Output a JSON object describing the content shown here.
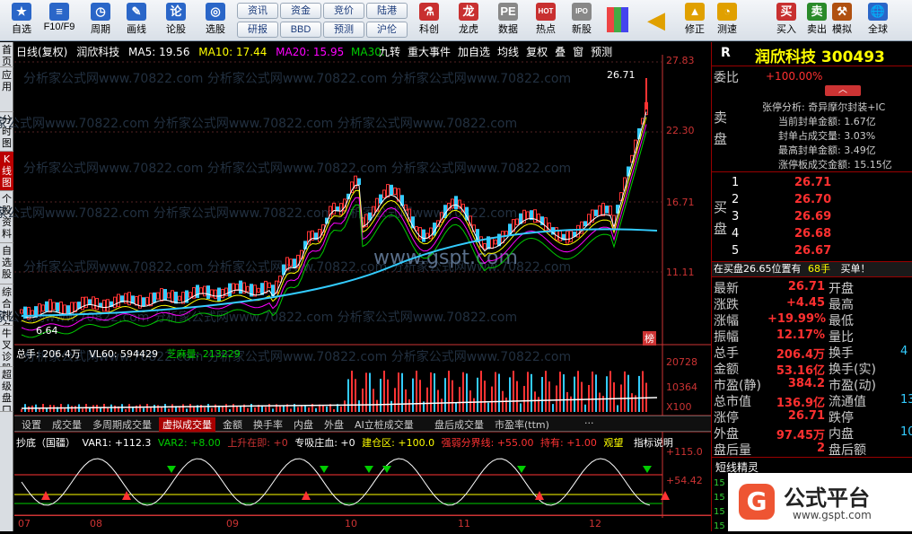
{
  "toolbar": {
    "buttons": [
      {
        "label": "自选",
        "icon": "star-icon",
        "color": "#2a66c8"
      },
      {
        "label": "F10/F9",
        "icon": "f10-icon",
        "color": "#2a66c8"
      },
      {
        "label": "周期",
        "icon": "clock-icon",
        "color": "#2a66c8"
      },
      {
        "label": "画线",
        "icon": "pencil-icon",
        "color": "#2a66c8"
      },
      {
        "label": "论股",
        "icon": "discuss-icon",
        "color": "#2a66c8"
      },
      {
        "label": "选股",
        "icon": "select-icon",
        "color": "#2a66c8"
      },
      {
        "label": "科创",
        "icon": "sci-icon",
        "color": "#c83030"
      },
      {
        "label": "龙虎",
        "icon": "dragon-icon",
        "color": "#c83030"
      },
      {
        "label": "数据",
        "icon": "pe-icon",
        "color": "#888"
      },
      {
        "label": "热点",
        "icon": "hot-icon",
        "color": "#c83030"
      },
      {
        "label": "新股",
        "icon": "ipo-icon",
        "color": "#888"
      },
      {
        "label": "修正",
        "icon": "arrow-up-icon",
        "color": "#e0a000"
      },
      {
        "label": "测速",
        "icon": "speed-icon",
        "color": "#e0a000"
      },
      {
        "label": "买入",
        "icon": "buy-icon",
        "color": "#c83030"
      },
      {
        "label": "卖出",
        "icon": "sell-icon",
        "color": "#2a8a2a"
      },
      {
        "label": "模拟",
        "icon": "hammer-icon",
        "color": "#b05010"
      },
      {
        "label": "全球",
        "icon": "globe-icon",
        "color": "#2a66c8"
      }
    ],
    "small": [
      "资讯",
      "资金",
      "竞价",
      "陆港",
      "研报",
      "BBD",
      "预测",
      "沪伦"
    ]
  },
  "leftbar": [
    {
      "label": "首页",
      "on": false
    },
    {
      "label": "应用",
      "on": false
    },
    {
      "label": "分时图",
      "on": false
    },
    {
      "label": "K线图",
      "on": true
    },
    {
      "label": "个股资料",
      "on": false
    },
    {
      "label": "自选股",
      "on": false
    },
    {
      "label": "综合排名",
      "on": false
    },
    {
      "label": "牛叉诊股",
      "on": false
    },
    {
      "label": "超级盘口",
      "on": false
    }
  ],
  "kline": {
    "header": {
      "period": "日线(复权)",
      "name": "润欣科技",
      "ma5": "MA5: 19.56",
      "ma10": "MA10: 17.44",
      "ma20": "MA20: 15.95",
      "ma30": "MA30:"
    },
    "menus": [
      "九转",
      "重大事件",
      "加自选",
      "均线",
      "复权",
      "叠",
      "窗",
      "预测"
    ],
    "prices": [
      "27.83",
      "22.30",
      "16.71",
      "11.11"
    ],
    "high_label": "26.71",
    "low_label": "6.64",
    "watermarks": [
      "分析家公式网www.70822.com 分析家公式网www.70822.com 分析家公式网www.70822.com"
    ],
    "wm2": "www.gspt.com",
    "board_tag": "榜"
  },
  "volume": {
    "header": {
      "total": "总手: 206.4万",
      "vl60": "VL60: 594429",
      "zhima": "芝麻量: 213229"
    },
    "scale": [
      "20728",
      "10364",
      "X100"
    ]
  },
  "tabs": [
    "设置",
    "成交量",
    "多周期成交量",
    "虚拟成交量",
    "金额",
    "换手率",
    "内盘",
    "外盘",
    "AI立桩成交量",
    "盘后成交量",
    "市盈率(ttm)",
    "···"
  ],
  "indicator": {
    "name": "抄底（国疆）",
    "var1": "VAR1: +112.3",
    "var2": "VAR2: +8.00",
    "up": "上升在即: +0",
    "zhuang": "专吸庄血: +0",
    "jiancang": "建仓区: +100.0",
    "qiangruo": "强弱分界线: +55.00",
    "chiyou": "持有: +1.00",
    "guanwang": "观望",
    "help": "指标说明",
    "scale": [
      "+115.0",
      "+54.42"
    ]
  },
  "xaxis": [
    "07",
    "08",
    "09",
    "10",
    "11",
    "12"
  ],
  "quote": {
    "code_prefix": "R",
    "title": "润欣科技 300493",
    "weibi_label": "委比",
    "weibi": "+100.00%",
    "sell_label": "卖盘",
    "buy_label": "买盘",
    "analysis": [
      "张停分析: 奇异摩尔封装+IC",
      "当前封单金额: 1.67亿",
      "封单占成交量: 3.03%",
      "最高封单金额: 3.49亿",
      "涨停板成交金额: 15.15亿"
    ],
    "bids": [
      {
        "n": "1",
        "p": "26.71"
      },
      {
        "n": "2",
        "p": "26.70"
      },
      {
        "n": "3",
        "p": "26.69"
      },
      {
        "n": "4",
        "p": "26.68"
      },
      {
        "n": "5",
        "p": "26.67"
      }
    ],
    "inbuy": "在买盘26.65位置有",
    "inbuy_qty": "68手",
    "inbuy_tag": "买单！",
    "rows": [
      {
        "l": "最新",
        "v": "26.71",
        "r": "开盘",
        "rv": ""
      },
      {
        "l": "涨跌",
        "v": "+4.45",
        "r": "最高",
        "rv": ""
      },
      {
        "l": "涨幅",
        "v": "+19.99%",
        "r": "最低",
        "rv": ""
      },
      {
        "l": "振幅",
        "v": "12.17%",
        "r": "量比",
        "rv": ""
      },
      {
        "l": "总手",
        "v": "206.4万",
        "r": "换手",
        "rv": "4"
      },
      {
        "l": "金额",
        "v": "53.16亿",
        "r": "换手(实)",
        "rv": ""
      },
      {
        "l": "市盈(静)",
        "v": "384.2",
        "r": "市盈(动)",
        "rv": ""
      },
      {
        "l": "总市值",
        "v": "136.9亿",
        "r": "流通值",
        "rv": "13"
      },
      {
        "l": "涨停",
        "v": "26.71",
        "r": "跌停",
        "rv": ""
      },
      {
        "l": "外盘",
        "v": "97.45万",
        "r": "内盘",
        "rv": "10"
      },
      {
        "l": "盘后量",
        "v": "2",
        "r": "盘后额",
        "rv": ""
      }
    ],
    "jingling": "短线精灵",
    "logo_text": "公式平台",
    "logo_url": "www.gspt.com"
  }
}
